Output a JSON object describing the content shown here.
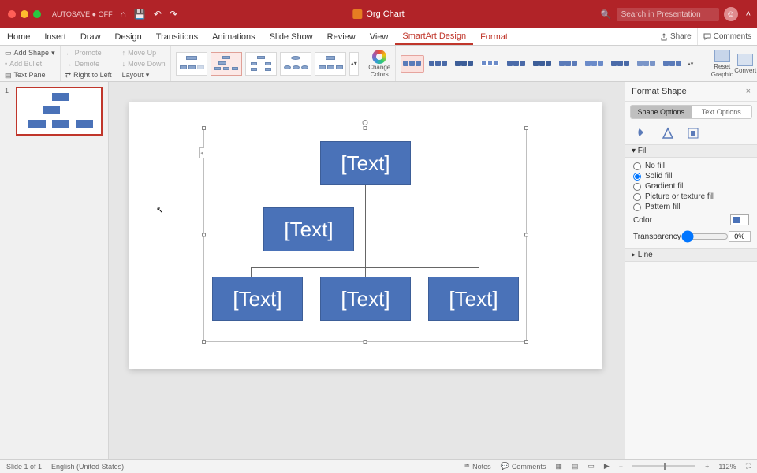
{
  "titlebar": {
    "autosave": "AUTOSAVE ● OFF",
    "doc_title": "Org Chart",
    "search_placeholder": "Search in Presentation"
  },
  "tabs": [
    "Home",
    "Insert",
    "Draw",
    "Design",
    "Transitions",
    "Animations",
    "Slide Show",
    "Review",
    "View",
    "SmartArt Design",
    "Format"
  ],
  "active_tab": "SmartArt Design",
  "near_tab": "Format",
  "tabright": {
    "share": "Share",
    "comments": "Comments"
  },
  "ribbon": {
    "addshape": "Add Shape",
    "addbullet": "Add Bullet",
    "textpane": "Text Pane",
    "promote": "Promote",
    "demote": "Demote",
    "rtl": "Right to Left",
    "moveup": "Move Up",
    "movedown": "Move Down",
    "layout": "Layout",
    "changecolors_l1": "Change",
    "changecolors_l2": "Colors",
    "reset_l1": "Reset",
    "reset_l2": "Graphic",
    "convert": "Convert"
  },
  "slide": {
    "number": "1",
    "nodes": {
      "top": "[Text]",
      "mid": "[Text]",
      "b1": "[Text]",
      "b2": "[Text]",
      "b3": "[Text]"
    },
    "sa_tab_glyph": "◂"
  },
  "format_pane": {
    "title": "Format Shape",
    "close": "×",
    "tab_shape": "Shape Options",
    "tab_text": "Text Options",
    "section_fill": "▾ Fill",
    "fill_options": {
      "none": "No fill",
      "solid": "Solid fill",
      "gradient": "Gradient fill",
      "picture": "Picture or texture fill",
      "pattern": "Pattern fill"
    },
    "fill_selected": "solid",
    "color": "Color",
    "transparency": "Transparency",
    "transparency_val": "0%",
    "section_line": "▸ Line"
  },
  "statusbar": {
    "slide_count": "Slide 1 of 1",
    "lang": "English (United States)",
    "notes": "Notes",
    "comments": "Comments",
    "zoom": "112%"
  },
  "colors": {
    "node": "#4a72b8",
    "accent": "#b12328"
  }
}
